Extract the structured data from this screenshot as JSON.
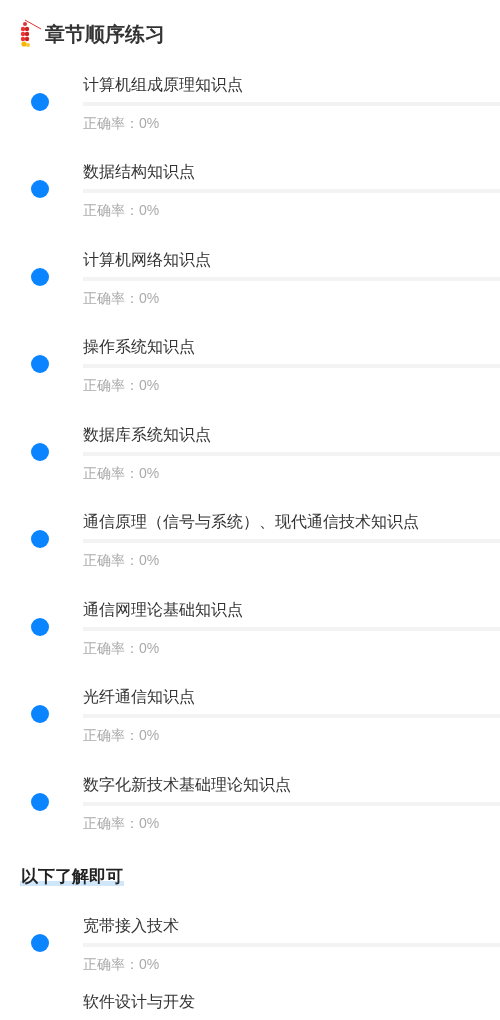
{
  "title": "章节顺序练习",
  "chapters": [
    {
      "name": "计算机组成原理知识点",
      "accuracy": "正确率：0%"
    },
    {
      "name": "数据结构知识点",
      "accuracy": "正确率：0%"
    },
    {
      "name": "计算机网络知识点",
      "accuracy": "正确率：0%"
    },
    {
      "name": "操作系统知识点",
      "accuracy": "正确率：0%"
    },
    {
      "name": "数据库系统知识点",
      "accuracy": "正确率：0%"
    },
    {
      "name": "通信原理（信号与系统）、现代通信技术知识点",
      "accuracy": "正确率：0%"
    },
    {
      "name": "通信网理论基础知识点",
      "accuracy": "正确率：0%"
    },
    {
      "name": "光纤通信知识点",
      "accuracy": "正确率：0%"
    },
    {
      "name": "数字化新技术基础理论知识点",
      "accuracy": "正确率：0%"
    }
  ],
  "optional_heading": "以下了解即可",
  "optional_chapters": [
    {
      "name": "宽带接入技术",
      "accuracy": "正确率：0%"
    },
    {
      "name": "软件设计与开发"
    }
  ]
}
